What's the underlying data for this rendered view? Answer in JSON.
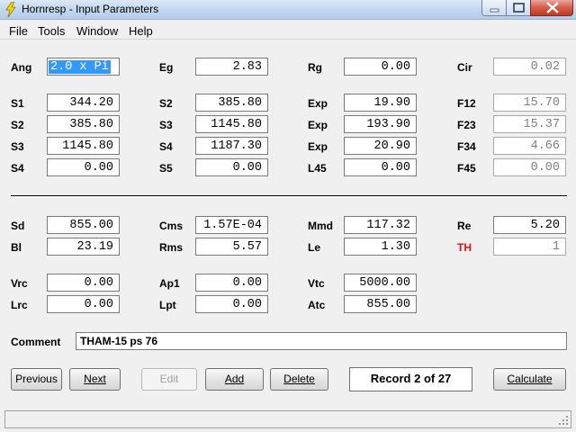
{
  "window": {
    "title": "Hornresp - Input Parameters",
    "titlebar_gradient": "#c3d7ef",
    "close_color": "#c4391f"
  },
  "menu": [
    "File",
    "Tools",
    "Window",
    "Help"
  ],
  "fields": {
    "Ang": "2.0 x Pi",
    "Eg": "2.83",
    "Rg": "0.00",
    "Cir": "0.02",
    "S1": "344.20",
    "S2_col2": "385.80",
    "Exp1": "19.90",
    "F12": "15.70",
    "S2": "385.80",
    "S3_col2": "1145.80",
    "Exp2": "193.90",
    "F23": "15.37",
    "S3": "1145.80",
    "S4_col2": "1187.30",
    "Exp3": "20.90",
    "F34": "4.66",
    "S4": "0.00",
    "S5": "0.00",
    "L45": "0.00",
    "F45": "0.00",
    "Sd": "855.00",
    "Cms": "1.57E-04",
    "Mmd": "117.32",
    "Re": "5.20",
    "Bl": "23.19",
    "Rms": "5.57",
    "Le": "1.30",
    "TH": "1",
    "Vrc": "0.00",
    "Ap1": "0.00",
    "Vtc": "5000.00",
    "Lrc": "0.00",
    "Lpt": "0.00",
    "Atc": "855.00"
  },
  "labels": {
    "Ang": "Ang",
    "Eg": "Eg",
    "Rg": "Rg",
    "Cir": "Cir",
    "S1": "S1",
    "S2": "S2",
    "S3": "S3",
    "S4": "S4",
    "S5": "S5",
    "Exp": "Exp",
    "L45": "L45",
    "F12": "F12",
    "F23": "F23",
    "F34": "F34",
    "F45": "F45",
    "Sd": "Sd",
    "Cms": "Cms",
    "Mmd": "Mmd",
    "Re": "Re",
    "Bl": "Bl",
    "Rms": "Rms",
    "Le": "Le",
    "TH": "TH",
    "Vrc": "Vrc",
    "Ap1": "Ap1",
    "Vtc": "Vtc",
    "Lrc": "Lrc",
    "Lpt": "Lpt",
    "Atc": "Atc",
    "Comment": "Comment"
  },
  "comment": "THAM-15 ps 76",
  "buttons": {
    "previous": "Previous",
    "next": "Next",
    "edit": "Edit",
    "add": "Add",
    "delete": "Delete",
    "calculate": "Calculate"
  },
  "record": "Record 2 of 27",
  "colors": {
    "th_label": "#e01010",
    "selection": "#3399ff"
  }
}
